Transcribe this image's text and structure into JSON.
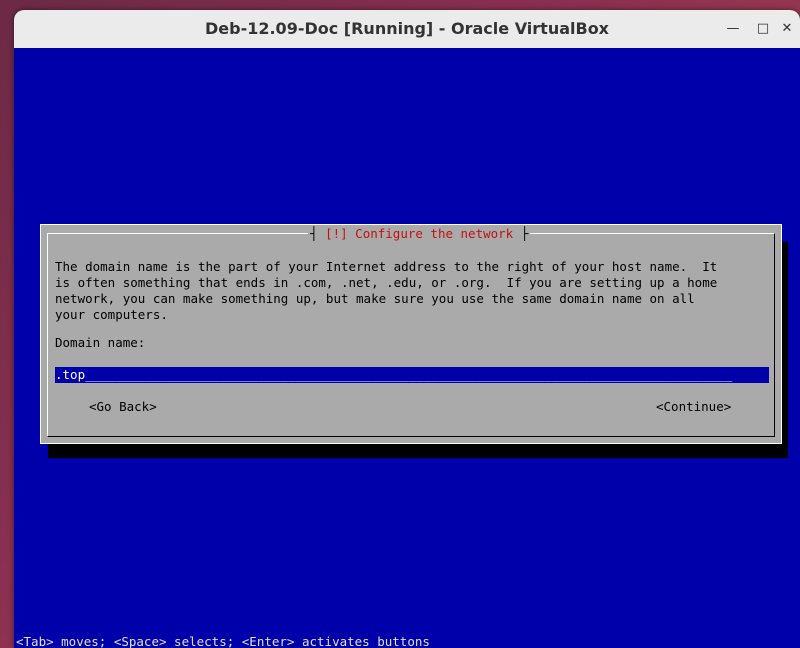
{
  "window": {
    "title": "Deb-12.09-Doc [Running] - Oracle VirtualBox",
    "minimize": "—",
    "maximize": "□",
    "close": "✕"
  },
  "dialog": {
    "title": "[!] Configure the network",
    "body": "The domain name is the part of your Internet address to the right of your host name.  It\nis often something that ends in .com, .net, .edu, or .org.  If you are setting up a home\nnetwork, you can make something up, but make sure you use the same domain name on all\nyour computers.",
    "field_label": "Domain name:",
    "field_value": ".top",
    "field_fill": "______________________________________________________________________________________",
    "go_back": "<Go Back>",
    "continue": "<Continue>"
  },
  "status_line": "<Tab> moves; <Space> selects; <Enter> activates buttons",
  "colors": {
    "screen_bg": "#0000aa",
    "dialog_bg": "#aaaaaa",
    "title_red": "#c41010"
  }
}
